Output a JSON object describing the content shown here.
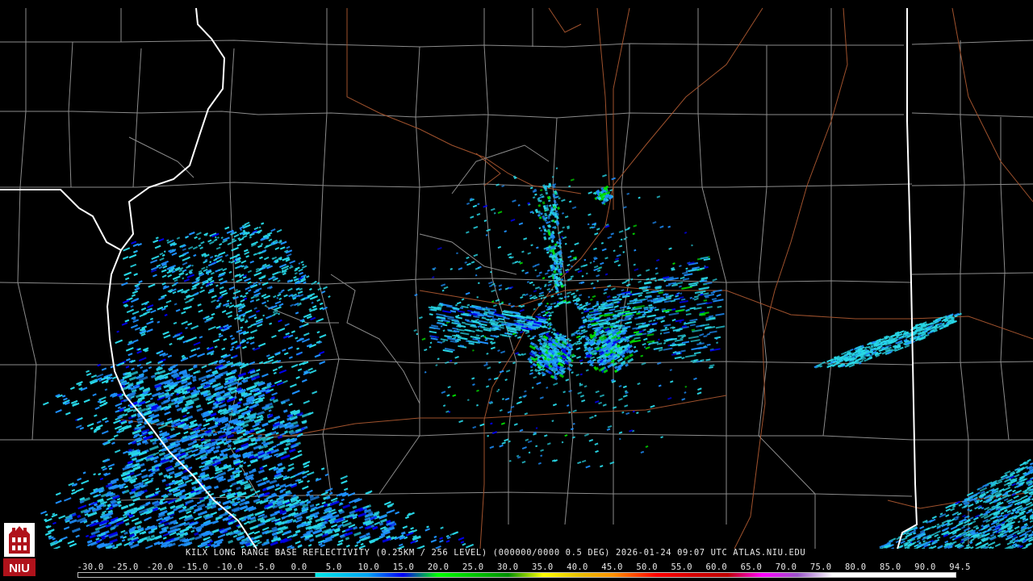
{
  "product_line": "KILX LONG RANGE BASE REFLECTIVITY (0.25KM / 256 LEVEL) (000000/0000 0.5 DEG) 2026-01-24 09:07 UTC  ATLAS.NIU.EDU",
  "logo_text": "NIU",
  "legend": {
    "labels": [
      "-30.0",
      "-25.0",
      "-20.0",
      "-15.0",
      "-10.0",
      "-5.0",
      "0.0",
      "5.0",
      "10.0",
      "15.0",
      "20.0",
      "25.0",
      "30.0",
      "35.0",
      "40.0",
      "45.0",
      "50.0",
      "55.0",
      "60.0",
      "65.0",
      "70.0",
      "75.0",
      "80.0",
      "85.0",
      "90.0",
      "94.5"
    ],
    "colors": [
      "#000000",
      "#000000",
      "#000000",
      "#000000",
      "#000000",
      "#000000",
      "#00e8e8",
      "#00a4f4",
      "#0000f6",
      "#00ff00",
      "#00c800",
      "#009000",
      "#ffff00",
      "#e7c000",
      "#ff9000",
      "#ff0000",
      "#d60000",
      "#c00000",
      "#ff00ff",
      "#9955c9",
      "#ffffff",
      "#ffffff",
      "#ffffff"
    ]
  },
  "map_colors": {
    "background": "#000000",
    "county_lines": "#8c8c8c",
    "state_lines": "#ffffff",
    "highways": "#a0522d",
    "echo_light": "#28d8e8",
    "echo_mid": "#1e90ff",
    "echo_heavy": "#0000f0",
    "echo_green": "#00e000"
  }
}
